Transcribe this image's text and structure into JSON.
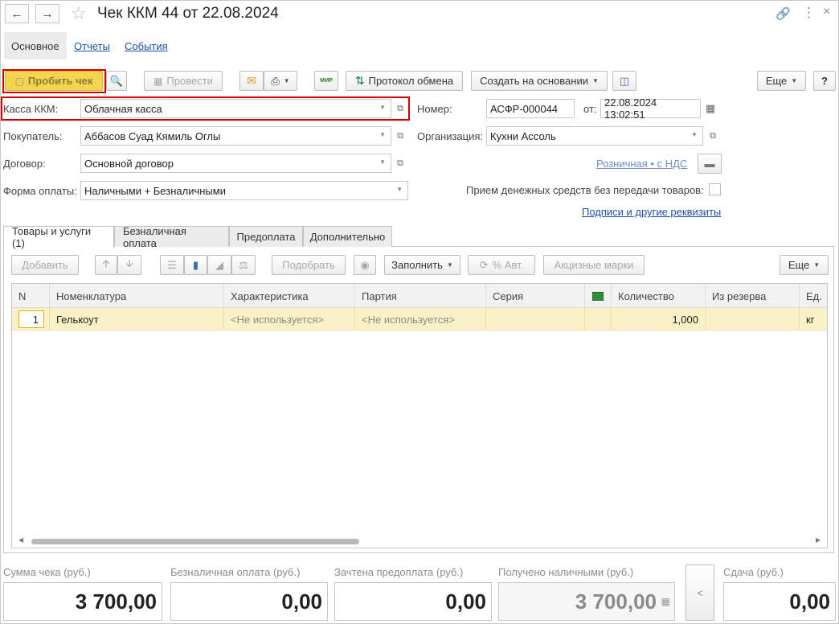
{
  "window": {
    "title": "Чек ККМ 44 от 22.08.2024"
  },
  "section_tabs": [
    "Основное",
    "Отчеты",
    "События"
  ],
  "toolbar": {
    "print_check": "Пробить чек",
    "post": "Провести",
    "mir": "МИР",
    "exchange_log": "Протокол обмена",
    "create_based": "Создать на основании",
    "more": "Еще",
    "help": "?"
  },
  "form": {
    "kassa_label": "Касса ККМ:",
    "kassa_value": "Облачная касса",
    "buyer_label": "Покупатель:",
    "buyer_value": "Аббасов Суад Кямиль Оглы",
    "contract_label": "Договор:",
    "contract_value": "Основной договор",
    "payment_label": "Форма оплаты:",
    "payment_value": "Наличными + Безналичными",
    "number_label": "Номер:",
    "number_value": "АСФР-000044",
    "date_label": "от:",
    "date_value": "22.08.2024 13:02:51",
    "org_label": "Организация:",
    "org_value": "Кухни Ассоль",
    "price_link": "Розничная • с НДС",
    "no_goods_label": "Прием денежных средств без передачи товаров:",
    "signatures_link": "Подписи и другие реквизиты"
  },
  "page_tabs": [
    "Товары и услуги (1)",
    "Безналичная оплата",
    "Предоплата",
    "Дополнительно"
  ],
  "table_toolbar": {
    "add": "Добавить",
    "select": "Подобрать",
    "fill": "Заполнить",
    "percent_auto": "% Авт.",
    "excise": "Акцизные марки",
    "more": "Еще"
  },
  "table": {
    "columns": [
      "N",
      "Номенклатура",
      "Характеристика",
      "Партия",
      "Серия",
      "",
      "Количество",
      "Из резерва",
      "Ед."
    ],
    "rows": [
      {
        "n": "1",
        "item": "Гелькоут",
        "char": "<Не используется>",
        "batch": "<Не используется>",
        "series": "",
        "flag": "",
        "qty": "1,000",
        "reserve": "",
        "unit": "кг"
      }
    ]
  },
  "totals": {
    "sum_label": "Сумма чека (руб.)",
    "sum_value": "3 700,00",
    "card_label": "Безналичная оплата (руб.)",
    "card_value": "0,00",
    "prepay_label": "Зачтена предоплата (руб.)",
    "prepay_value": "0,00",
    "cash_label": "Получено наличными (руб.)",
    "cash_value": "3 700,00",
    "change_btn": "<",
    "change_label": "Сдача (руб.)",
    "change_value": "0,00"
  },
  "colors": {
    "highlight": "#d40000",
    "primary_button": "#f3d54f",
    "link": "#1a53a6",
    "selected_row": "#fbf1c6"
  }
}
